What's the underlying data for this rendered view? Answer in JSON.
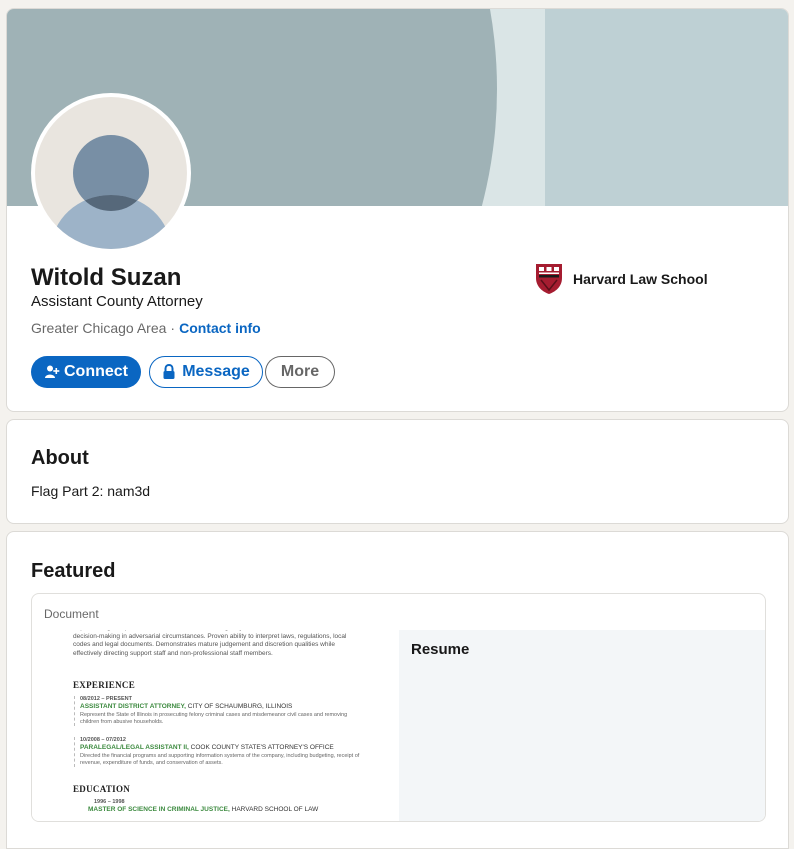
{
  "profile": {
    "name": "Witold Suzan",
    "headline": "Assistant County Attorney",
    "location": "Greater Chicago Area",
    "separator": "·",
    "contact_label": "Contact info",
    "school": "Harvard Law School",
    "actions": {
      "connect_label": "Connect",
      "message_label": "Message",
      "more_label": "More"
    }
  },
  "about": {
    "title": "About",
    "text": "Flag Part 2: nam3d"
  },
  "featured": {
    "title": "Featured",
    "item": {
      "type": "Document",
      "title": "Resume",
      "preview": {
        "summary": "of presenting complex trials and statements of fact logically in written and verbal form, and decision-making in adversarial circumstances. Proven ability to interpret laws, regulations, local codes and legal documents. Demonstrates mature judgement and discretion qualities while effectively directing support staff and non-professional staff members.",
        "experience_heading": "EXPERIENCE",
        "jobs": [
          {
            "dates": "08/2012 – PRESENT",
            "title": "ASSISTANT DISTRICT ATTORNEY,",
            "org": " CITY OF SCHAUMBURG, ILLINOIS",
            "desc": "Represent the State of Illinois in prosecuting felony criminal cases and misdemeanor civil cases and removing children from abusive households."
          },
          {
            "dates": "10/2008 – 07/2012",
            "title": "PARALEGAL/LEGAL ASSISTANT II,",
            "org": " COOK COUNTY STATE'S ATTORNEY'S OFFICE",
            "desc": "Directed the financial programs and supporting information systems of the company, including budgeting, receipt of revenue, expenditure of funds, and conservation of assets."
          }
        ],
        "education_heading": "EDUCATION",
        "education": {
          "dates": "1996 – 1998",
          "degree": "MASTER OF SCIENCE IN CRIMINAL JUSTICE,",
          "school": " HARVARD SCHOOL OF LAW"
        }
      }
    }
  },
  "colors": {
    "accent": "#0a66c2",
    "banner_dark": "#9fb2b6",
    "banner_light": "#bed0d4",
    "resume_green": "#3c8a3f",
    "harvard_crimson": "#a51c30"
  },
  "icons": {
    "connect": "person-add-icon",
    "message": "lock-icon",
    "school": "harvard-shield-logo"
  }
}
